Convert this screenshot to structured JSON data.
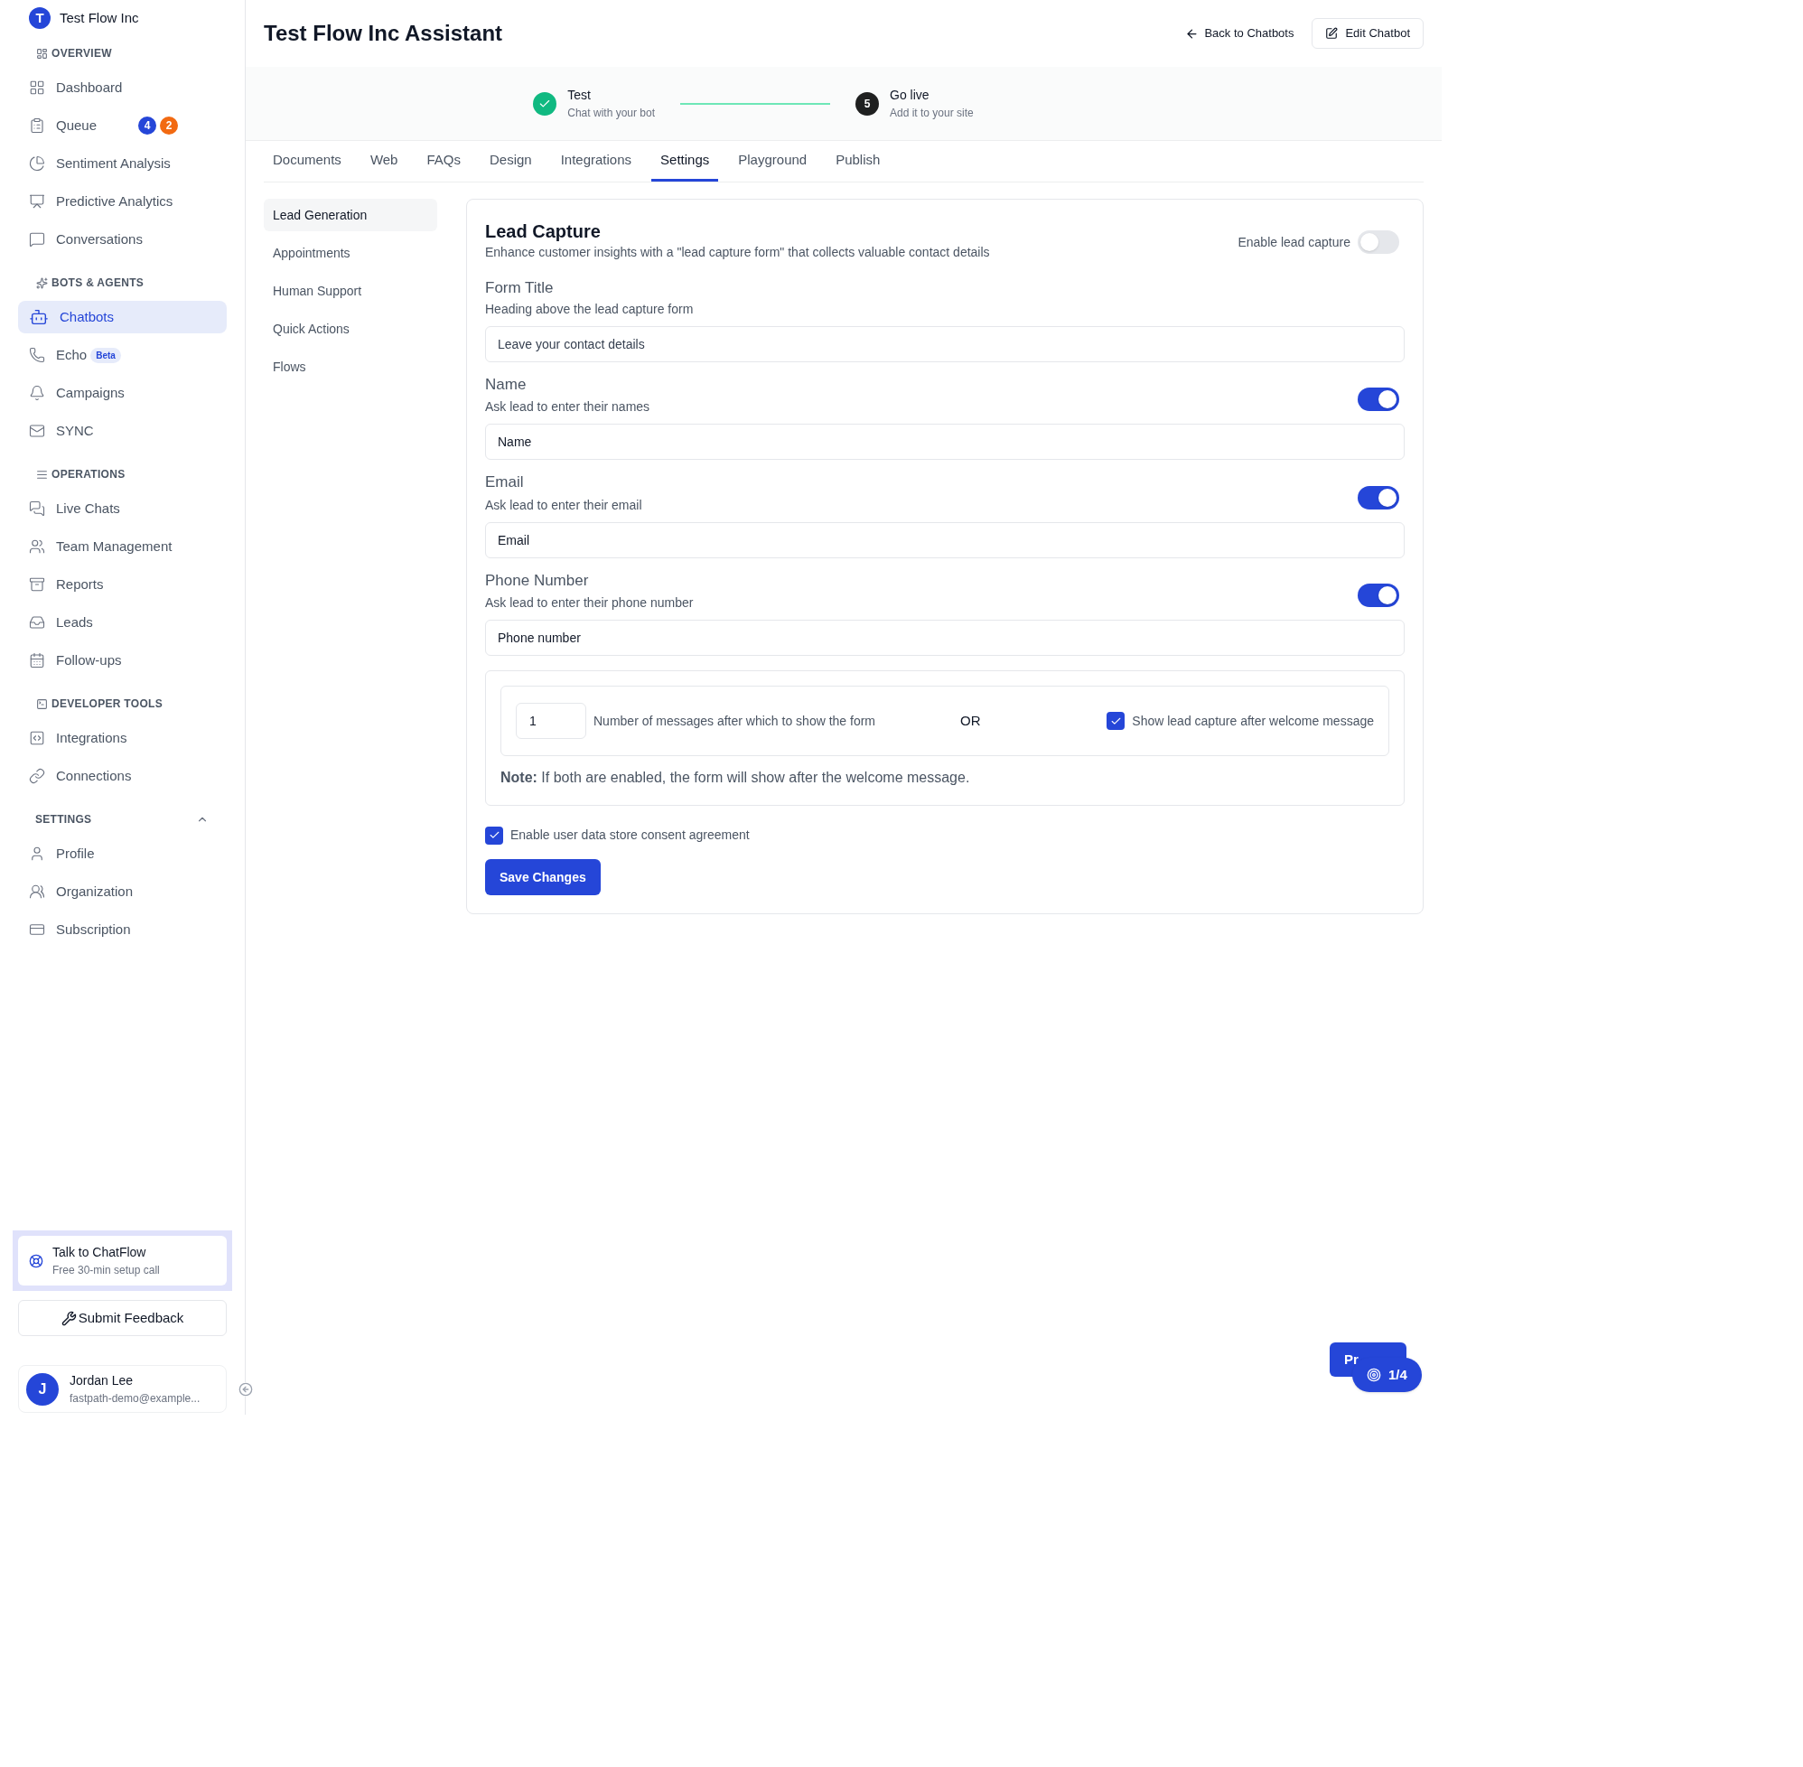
{
  "sidebar": {
    "org": {
      "initial": "T",
      "name": "Test Flow Inc"
    },
    "sections": [
      {
        "title": "OVERVIEW",
        "items": [
          {
            "label": "Dashboard",
            "selected": false
          },
          {
            "label": "Queue",
            "selected": false,
            "badges": [
              {
                "text": "4",
                "color": "#2546d8"
              },
              {
                "text": "2",
                "color": "#f26a12"
              }
            ]
          },
          {
            "label": "Sentiment Analysis",
            "selected": false
          },
          {
            "label": "Predictive Analytics",
            "selected": false
          },
          {
            "label": "Conversations",
            "selected": false
          }
        ]
      },
      {
        "title": "BOTS & AGENTS",
        "items": [
          {
            "label": "Chatbots",
            "selected": true
          },
          {
            "label": "Echo",
            "selected": false,
            "tag": "Beta"
          },
          {
            "label": "Campaigns",
            "selected": false
          },
          {
            "label": "SYNC",
            "selected": false
          }
        ]
      },
      {
        "title": "OPERATIONS",
        "items": [
          {
            "label": "Live Chats",
            "selected": false
          },
          {
            "label": "Team Management",
            "selected": false
          },
          {
            "label": "Reports",
            "selected": false
          },
          {
            "label": "Leads",
            "selected": false
          },
          {
            "label": "Follow-ups",
            "selected": false
          }
        ]
      },
      {
        "title": "DEVELOPER TOOLS",
        "items": [
          {
            "label": "Integrations",
            "selected": false
          },
          {
            "label": "Connections",
            "selected": false
          }
        ]
      },
      {
        "title": "SETTINGS",
        "expanded": true,
        "items": [
          {
            "label": "Profile",
            "selected": false
          },
          {
            "label": "Organization",
            "selected": false
          },
          {
            "label": "Subscription",
            "selected": false
          }
        ]
      }
    ],
    "call_card": {
      "title": "Talk to ChatFlow",
      "subtitle": "Free 30-min setup call"
    },
    "feedback_button": "Submit Feedback",
    "user": {
      "initial": "J",
      "name": "Jordan Lee",
      "email": "fastpath-demo@example..."
    }
  },
  "header": {
    "title": "Test Flow Inc Assistant",
    "back_link": "Back to Chatbots",
    "edit_button": "Edit Chatbot"
  },
  "stepper": [
    {
      "completed": true,
      "title": "Test",
      "subtitle": "Chat with your bot"
    },
    {
      "completed": false,
      "marker": "5",
      "title": "Go live",
      "subtitle": "Add it to your site"
    }
  ],
  "tabs": [
    {
      "label": "Documents",
      "selected": false
    },
    {
      "label": "Web",
      "selected": false
    },
    {
      "label": "FAQs",
      "selected": false
    },
    {
      "label": "Design",
      "selected": false
    },
    {
      "label": "Integrations",
      "selected": false
    },
    {
      "label": "Settings",
      "selected": true
    },
    {
      "label": "Playground",
      "selected": false
    },
    {
      "label": "Publish",
      "selected": false
    }
  ],
  "subnav": [
    {
      "label": "Lead Generation",
      "selected": true
    },
    {
      "label": "Appointments",
      "selected": false
    },
    {
      "label": "Human Support",
      "selected": false
    },
    {
      "label": "Quick Actions",
      "selected": false
    },
    {
      "label": "Flows",
      "selected": false
    }
  ],
  "lead_capture": {
    "title": "Lead Capture",
    "description": "Enhance customer insights with a \"lead capture form\" that collects valuable contact details",
    "enable_label": "Enable lead capture",
    "enabled": false,
    "form_title": {
      "label": "Form Title",
      "hint": "Heading above the lead capture form",
      "placeholder": "Leave your contact details"
    },
    "fields": [
      {
        "label": "Name",
        "hint": "Ask lead to enter their names",
        "on": true,
        "value": "Name"
      },
      {
        "label": "Email",
        "hint": "Ask lead to enter their email",
        "on": true,
        "value": "Email"
      },
      {
        "label": "Phone Number",
        "hint": "Ask lead to enter their phone number",
        "on": true,
        "value": "Phone number"
      }
    ],
    "trigger": {
      "count": "1",
      "count_label": "Number of messages after which to show the form",
      "or": "OR",
      "welcome_label": "Show lead capture after welcome message",
      "welcome_checked": true,
      "note": "**Note:** If both are enabled, the form will show after the welcome message."
    },
    "consent_label": "Enable user data store consent agreement",
    "consent_checked": true,
    "save_button": "Save Changes"
  },
  "floating": {
    "preview_button": "Pr",
    "tour_badge": "1/4"
  }
}
